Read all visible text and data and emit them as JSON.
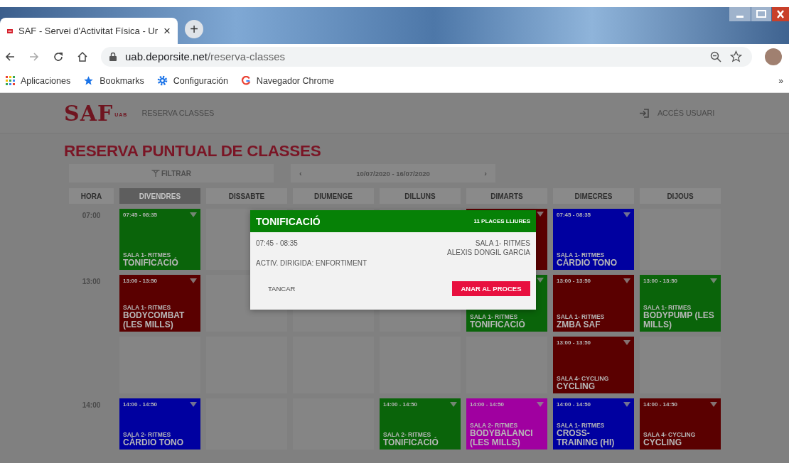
{
  "browser": {
    "tab_title": "SAF - Servei d'Activitat Física - Ur",
    "tab_close": "×",
    "new_tab": "+",
    "url_domain": "uab.deporsite.net",
    "url_path": "/reserva-classes",
    "bookmarks": [
      "Aplicaciones",
      "Bookmarks",
      "Configuración",
      "Navegador Chrome"
    ],
    "bookmarks_more": "»"
  },
  "site": {
    "logo": "SAF",
    "logo_small": "UAB",
    "nav": "RESERVA CLASSES",
    "login": "ACCÉS USUARI",
    "title": "RESERVA PUNTUAL DE CLASSES",
    "filter": "FILTRAR",
    "prev": "‹",
    "date_range": "10/07/2020 - 16/07/2020",
    "next": "›"
  },
  "schedule": {
    "hour_header": "HORA",
    "days": [
      {
        "label": "DIVENDRES",
        "selected": true
      },
      {
        "label": "DISSABTE",
        "selected": false
      },
      {
        "label": "DIUMENGE",
        "selected": false
      },
      {
        "label": "DILLUNS",
        "selected": false
      },
      {
        "label": "DIMARTS",
        "selected": false
      },
      {
        "label": "DIMECRES",
        "selected": false
      },
      {
        "label": "DIJOUS",
        "selected": false
      }
    ],
    "rows": [
      {
        "time": "07:00",
        "cells": [
          {
            "kind": "class",
            "color": "#0a640a",
            "time": "07:45 - 08:35",
            "room": "SALA 1- RITMES",
            "name": "TONIFICACIÓ"
          },
          {
            "kind": "empty"
          },
          {
            "kind": "empty"
          },
          {
            "kind": "empty"
          },
          {
            "kind": "class",
            "color": "#5a0000"
          },
          {
            "kind": "class",
            "color": "#0000a0",
            "time": "07:45 - 08:35",
            "room": "SALA 1- RITMES",
            "name": "CÀRDIO TONO"
          },
          {
            "kind": "empty"
          }
        ]
      },
      {
        "time": "13:00",
        "cells": [
          {
            "kind": "class",
            "color": "#5a0000",
            "time": "13:00 - 13:50",
            "room": "SALA 1- RITMES",
            "name": "BODYCOMBAT (LES MILLS)"
          },
          {
            "kind": "empty"
          },
          {
            "kind": "empty"
          },
          {
            "kind": "empty"
          },
          {
            "kind": "class",
            "color": "#0a640a",
            "room": "SALA 1- RITMES",
            "name": "TONIFICACIÓ"
          },
          {
            "kind": "class",
            "color": "#5a0000",
            "time": "13:00 - 13:50",
            "room": "SALA 1- RITMES",
            "name": "ZMBA SAF"
          },
          {
            "kind": "class",
            "color": "#0a640a",
            "time": "13:00 - 13:50",
            "room": "SALA 1- RITMES",
            "name": "BODYPUMP (LES MILLS)"
          }
        ]
      },
      {
        "cells": [
          {
            "kind": "empty"
          },
          {
            "kind": "empty"
          },
          {
            "kind": "empty"
          },
          {
            "kind": "empty"
          },
          {
            "kind": "empty"
          },
          {
            "kind": "class",
            "color": "#5a0000",
            "time": "13:00 - 13:50",
            "room": "SALA 4- CYCLING",
            "name": "CYCLING"
          },
          {
            "kind": "empty"
          }
        ]
      },
      {
        "time": "14:00",
        "cells": [
          {
            "kind": "class",
            "color": "#0000a0",
            "time": "14:00 - 14:50",
            "room": "SALA 2- RITMES",
            "name": "CÀRDIO TONO"
          },
          {
            "kind": "empty"
          },
          {
            "kind": "empty"
          },
          {
            "kind": "class",
            "color": "#0a640a",
            "time": "14:00 - 14:50",
            "room": "SALA 2- RITMES",
            "name": "TONIFICACIÓ"
          },
          {
            "kind": "class",
            "color": "#a000a0",
            "time": "14:00 - 14:50",
            "room": "SALA 2- RITMES",
            "name": "BODYBALANCI (LES MILLS)"
          },
          {
            "kind": "class",
            "color": "#0000a0",
            "time": "14:00 - 14:50",
            "room": "SALA 1- RITMES",
            "name": "CROSS-TRAINING (HI)"
          },
          {
            "kind": "class",
            "color": "#5a0000",
            "time": "14:00 - 14:50",
            "room": "SALA 4- CYCLING",
            "name": "CYCLING"
          }
        ]
      }
    ]
  },
  "dialog": {
    "title": "TONIFICACIÓ",
    "places": "11 PLACES LLIURES",
    "time": "07:45 - 08:35",
    "room": "SALA 1- RITMES",
    "instructor": "ALEXIS DONGIL GARCIA",
    "category": "ACTIV. DIRIGIDA: ENFORTIMENT",
    "buttons": [
      "TANCAR",
      "ANAR AL PROCES"
    ]
  }
}
